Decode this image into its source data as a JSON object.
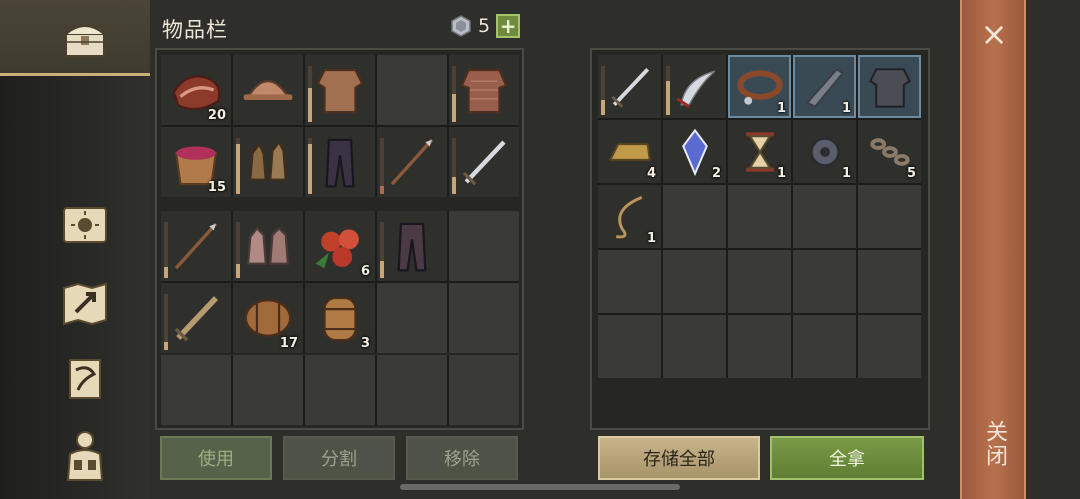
{
  "inventory": {
    "title": "物品栏",
    "gem_count": "5",
    "plus": "+"
  },
  "left_bag": [
    {
      "icon": "bacon-icon",
      "qty": "20"
    },
    {
      "icon": "helmet-icon",
      "qty": ""
    },
    {
      "icon": "leather-armor-icon",
      "qty": "",
      "dur": 0.6
    },
    {
      "icon": "",
      "qty": ""
    },
    {
      "icon": "chainmail-shirt-icon",
      "qty": "",
      "dur": 0.5
    },
    {
      "icon": "berry-bucket-icon",
      "qty": "15"
    },
    {
      "icon": "leather-gloves-icon",
      "qty": "",
      "dur": 0.9
    },
    {
      "icon": "leather-pants-icon",
      "qty": "",
      "dur": 0.9
    },
    {
      "icon": "spear-icon",
      "qty": "",
      "dur": 0.15,
      "red": true
    },
    {
      "icon": "sword-icon",
      "qty": "",
      "dur": 0.3
    }
  ],
  "left_bag2": [
    {
      "icon": "spear-icon",
      "qty": "",
      "dur": 0.2
    },
    {
      "icon": "chain-gloves-icon",
      "qty": "",
      "dur": 0.25
    },
    {
      "icon": "apples-icon",
      "qty": "6"
    },
    {
      "icon": "pants-icon",
      "qty": "",
      "dur": 0.3
    },
    {
      "icon": "",
      "qty": ""
    },
    {
      "icon": "wooden-sword-icon",
      "qty": "",
      "dur": 0.15
    },
    {
      "icon": "barrel-icon",
      "qty": "17"
    },
    {
      "icon": "keg-icon",
      "qty": "3"
    },
    {
      "icon": "",
      "qty": ""
    },
    {
      "icon": "",
      "qty": ""
    }
  ],
  "right_chest": [
    {
      "icon": "sword-icon",
      "qty": "",
      "dur": 0.3
    },
    {
      "icon": "scimitar-icon",
      "qty": "",
      "dur": 0.7
    },
    {
      "icon": "collar-icon",
      "qty": "1",
      "hl": true
    },
    {
      "icon": "weapon-part-icon",
      "qty": "1",
      "hl": true
    },
    {
      "icon": "plate-armor-icon",
      "qty": "",
      "hl": true
    },
    {
      "icon": "gold-ingot-icon",
      "qty": "4"
    },
    {
      "icon": "crystal-icon",
      "qty": "2"
    },
    {
      "icon": "hourglass-icon",
      "qty": "1"
    },
    {
      "icon": "gear-icon",
      "qty": "1"
    },
    {
      "icon": "chain-icon",
      "qty": "5"
    },
    {
      "icon": "rope-icon",
      "qty": "1"
    }
  ],
  "buttons": {
    "use": "使用",
    "split": "分割",
    "remove": "移除",
    "store_all": "存储全部",
    "take_all": "全拿"
  },
  "close": {
    "x": "×",
    "label": "关闭"
  }
}
